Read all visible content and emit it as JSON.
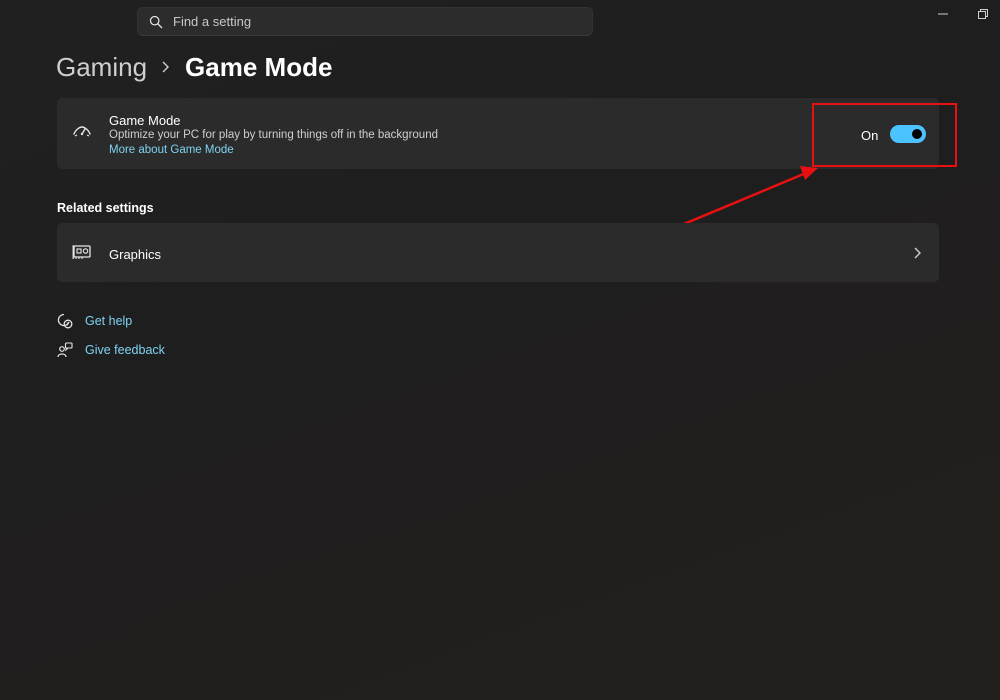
{
  "search": {
    "placeholder": "Find a setting",
    "icon": "search-icon"
  },
  "breadcrumb": {
    "parent": "Gaming",
    "current": "Game Mode"
  },
  "game_mode": {
    "title": "Game Mode",
    "description": "Optimize your PC for play by turning things off in the background",
    "link": "More about Game Mode",
    "toggle_label": "On",
    "toggle_on": true,
    "icon": "game-mode-icon"
  },
  "related": {
    "title": "Related settings",
    "items": [
      {
        "label": "Graphics",
        "icon": "graphics-card-icon"
      }
    ]
  },
  "help": {
    "get_help": "Get help",
    "give_feedback": "Give feedback"
  },
  "colors": {
    "background": "#202020",
    "card": "#2b2b2b",
    "accent": "#4cc2ff",
    "link": "#7fd3f2",
    "annotation": "#e81010"
  }
}
